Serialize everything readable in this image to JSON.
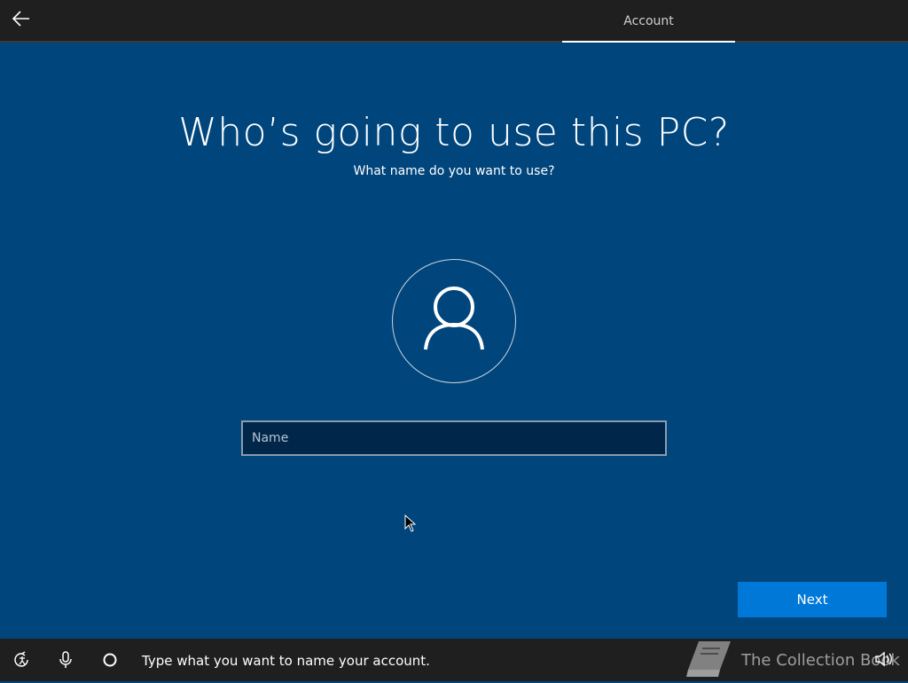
{
  "header": {
    "back_icon": "arrow-left-icon",
    "tab_label": "Account"
  },
  "main": {
    "title": "Who’s going to use this PC?",
    "subtitle": "What name do you want to use?",
    "avatar_icon": "user-icon",
    "name_input": {
      "placeholder": "Name",
      "value": ""
    },
    "next_label": "Next"
  },
  "footer": {
    "icons": [
      "ease-of-access-icon",
      "microphone-icon",
      "cortana-circle-icon",
      "volume-icon"
    ],
    "hint_text": "Type what you want to name your account.",
    "watermark_text": "The Collection Book"
  },
  "colors": {
    "background": "#00457c",
    "bar": "#1f1f1f",
    "accent": "#0078d7",
    "input_bg": "#00264a"
  }
}
